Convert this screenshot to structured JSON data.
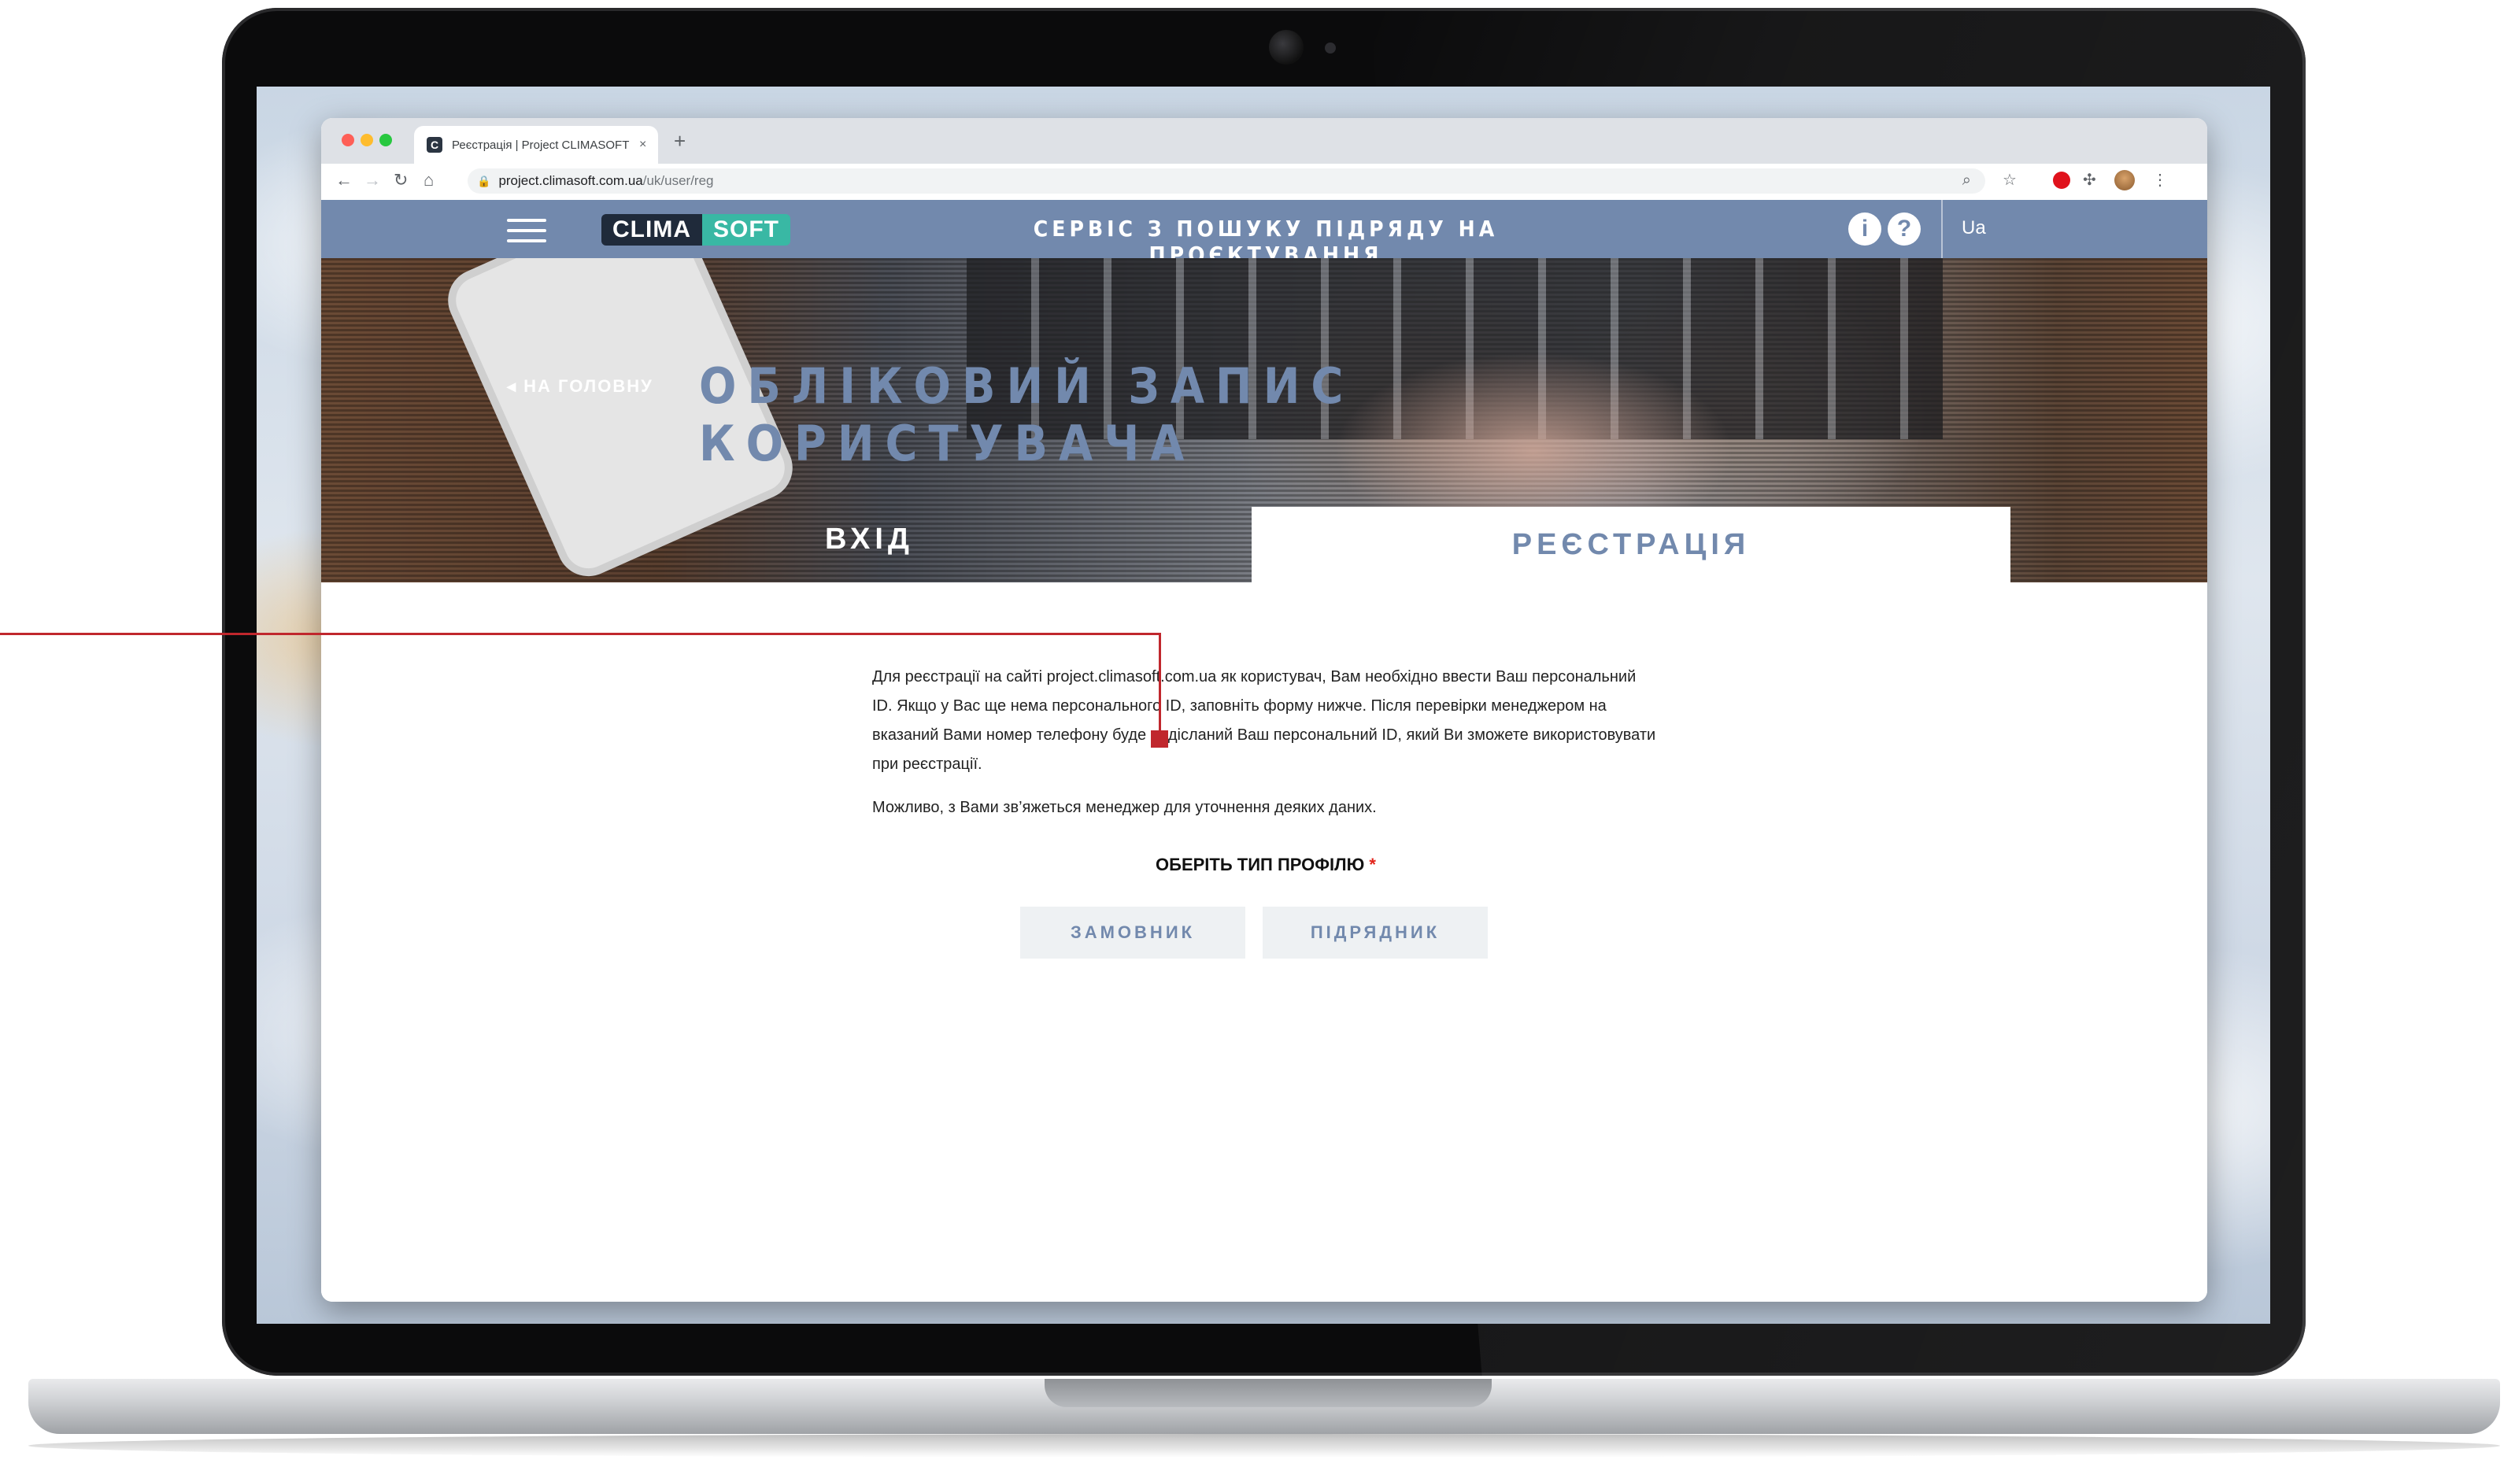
{
  "browser": {
    "tab_title": "Реєстрація | Project CLIMASOFT",
    "tab_close": "×",
    "new_tab": "+",
    "url_host": "project.climasoft.com.ua",
    "url_path": "/uk/user/reg"
  },
  "header": {
    "logo_left": "CLIMA",
    "logo_right": "SOFT",
    "title": "СЕРВІС З ПОШУКУ ПІДРЯДУ НА ПРОЄКТУВАННЯ",
    "info_label": "i",
    "help_label": "?",
    "language": "Ua"
  },
  "hero": {
    "back_link": "◂ НА ГОЛОВНУ",
    "title": "ОБЛІКОВИЙ ЗАПИС КОРИСТУВАЧА",
    "tab_login": "ВХІД",
    "tab_register": "РЕЄСТРАЦІЯ"
  },
  "content": {
    "intro_p1": "Для реєстрації на сайті project.climasoft.com.ua як користувач, Вам необхідно ввести Ваш персональний ID. Якщо у Вас ще нема персонального ID, заповніть форму нижче. Після перевірки менеджером на вказаний Вами номер телефону буде надісланий Ваш персональний ID, який Ви зможете використовувати при реєстрації.",
    "intro_p2": "Можливо, з Вами зв’яжеться менеджер для уточнення деяких даних.",
    "choose_label": "ОБЕРІТЬ ТИП ПРОФІЛЮ",
    "required_mark": "*",
    "btn_customer": "ЗАМОВНИК",
    "btn_contractor": "ПІДРЯДНИК"
  },
  "colors": {
    "brand_blue": "#7289ad",
    "logo_dark": "#1f2a3a",
    "logo_teal": "#39b8a4",
    "required_red": "#e2231a",
    "annotation_red": "#c0272d"
  }
}
